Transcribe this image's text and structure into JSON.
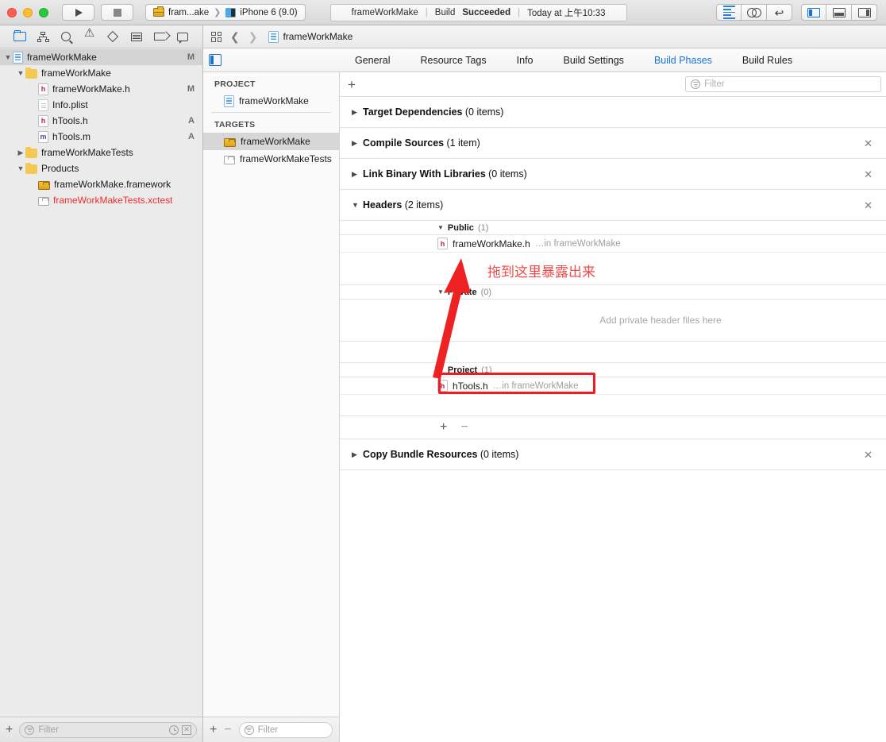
{
  "toolbar": {
    "scheme": {
      "project": "fram...ake",
      "separator": "❯",
      "destination": "iPhone 6 (9.0)"
    },
    "status": {
      "project": "frameWorkMake",
      "build_label": "Build",
      "build_result": "Succeeded",
      "time": "Today at 上午10:33",
      "divider": "|"
    }
  },
  "navigator": {
    "toolbar_icons": [
      "folder-icon",
      "hierarchy-icon",
      "search-icon",
      "warning-icon",
      "diamond-icon",
      "list-icon",
      "tag-icon",
      "comment-icon"
    ],
    "tree": [
      {
        "label": "frameWorkMake",
        "icon": "project-icon",
        "indent": 0,
        "disclosure": "▼",
        "badge": "M",
        "selected": true,
        "color": "normal"
      },
      {
        "label": "frameWorkMake",
        "icon": "folder-icon",
        "indent": 1,
        "disclosure": "▼",
        "badge": "",
        "selected": false,
        "color": "normal"
      },
      {
        "label": "frameWorkMake.h",
        "icon": "header-file-icon",
        "indent": 2,
        "disclosure": "",
        "badge": "M",
        "selected": false,
        "color": "normal"
      },
      {
        "label": "Info.plist",
        "icon": "plist-file-icon",
        "indent": 2,
        "disclosure": "",
        "badge": "",
        "selected": false,
        "color": "normal"
      },
      {
        "label": "hTools.h",
        "icon": "header-file-icon",
        "indent": 2,
        "disclosure": "",
        "badge": "A",
        "selected": false,
        "color": "normal"
      },
      {
        "label": "hTools.m",
        "icon": "objc-file-icon",
        "indent": 2,
        "disclosure": "",
        "badge": "A",
        "selected": false,
        "color": "normal"
      },
      {
        "label": "frameWorkMakeTests",
        "icon": "folder-icon",
        "indent": 1,
        "disclosure": "▶",
        "badge": "",
        "selected": false,
        "color": "normal"
      },
      {
        "label": "Products",
        "icon": "folder-icon",
        "indent": 1,
        "disclosure": "▼",
        "badge": "",
        "selected": false,
        "color": "normal"
      },
      {
        "label": "frameWorkMake.framework",
        "icon": "framework-icon",
        "indent": 2,
        "disclosure": "",
        "badge": "",
        "selected": false,
        "color": "normal"
      },
      {
        "label": "frameWorkMakeTests.xctest",
        "icon": "xctest-icon",
        "indent": 2,
        "disclosure": "",
        "badge": "",
        "selected": false,
        "color": "red"
      }
    ],
    "filter_placeholder": "Filter"
  },
  "jump_bar": {
    "breadcrumb": "frameWorkMake",
    "back": "❮",
    "forward": "❯"
  },
  "editor": {
    "tabs": [
      {
        "label": "General",
        "active": false
      },
      {
        "label": "Resource Tags",
        "active": false
      },
      {
        "label": "Info",
        "active": false
      },
      {
        "label": "Build Settings",
        "active": false
      },
      {
        "label": "Build Phases",
        "active": true
      },
      {
        "label": "Build Rules",
        "active": false
      }
    ],
    "project_list": {
      "project_header": "PROJECT",
      "project_items": [
        {
          "label": "frameWorkMake",
          "icon": "project-icon",
          "selected": false
        }
      ],
      "targets_header": "TARGETS",
      "target_items": [
        {
          "label": "frameWorkMake",
          "icon": "framework-icon",
          "selected": true
        },
        {
          "label": "frameWorkMakeTests",
          "icon": "xctest-icon",
          "selected": false
        }
      ],
      "filter_placeholder": "Filter",
      "add_label": "+",
      "remove_label": "−"
    },
    "phases_toolbar": {
      "add_label": "+",
      "filter_placeholder": "Filter"
    },
    "phases": [
      {
        "title": "Target Dependencies",
        "count": "(0 items)",
        "expanded": false,
        "closable": false
      },
      {
        "title": "Compile Sources",
        "count": "(1 item)",
        "expanded": false,
        "closable": true
      },
      {
        "title": "Link Binary With Libraries",
        "count": "(0 items)",
        "expanded": false,
        "closable": true
      },
      {
        "title": "Headers",
        "count": "(2 items)",
        "expanded": true,
        "closable": true
      },
      {
        "title": "Copy Bundle Resources",
        "count": "(0 items)",
        "expanded": false,
        "closable": true
      }
    ],
    "headers": {
      "public": {
        "name": "Public",
        "count": "(1)",
        "files": [
          {
            "name": "frameWorkMake.h",
            "location": "…in frameWorkMake",
            "icon": "header-file-icon"
          }
        ]
      },
      "private": {
        "name": "Private",
        "count": "(0)",
        "empty_text": "Add private header files here",
        "files": []
      },
      "project": {
        "name": "Project",
        "count": "(1)",
        "files": [
          {
            "name": "hTools.h",
            "location": "…in frameWorkMake",
            "icon": "header-file-icon",
            "highlighted": true
          }
        ]
      },
      "add_label": "+",
      "remove_label": "−"
    }
  },
  "annotations": {
    "note_text": "拖到这里暴露出来",
    "note_color": "#f04a4a",
    "highlight_color": "#ee1c25",
    "arrow_color": "#ee2222"
  }
}
